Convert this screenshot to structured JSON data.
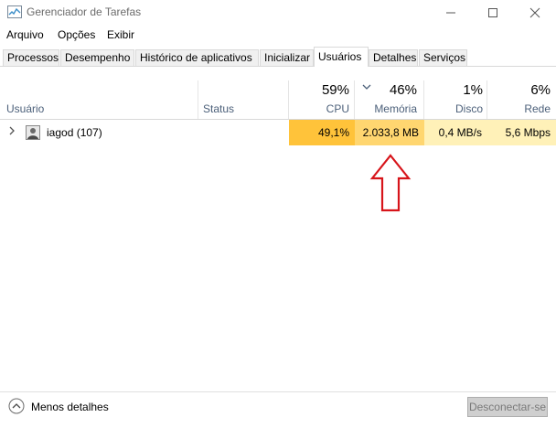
{
  "window": {
    "title": "Gerenciador de Tarefas",
    "minimize_icon": "minimize-icon",
    "maximize_icon": "maximize-icon",
    "close_icon": "close-icon"
  },
  "menu": [
    "Arquivo",
    "Opções",
    "Exibir"
  ],
  "tabs": [
    "Processos",
    "Desempenho",
    "Histórico de aplicativos",
    "Inicializar",
    "Usuários",
    "Detalhes",
    "Serviços"
  ],
  "active_tab": "Usuários",
  "columns": {
    "user": {
      "label": "Usuário"
    },
    "status": {
      "label": "Status"
    },
    "cpu": {
      "label": "CPU",
      "percent": "59%"
    },
    "memory": {
      "label": "Memória",
      "percent": "46%",
      "sort_icon": "chevron-down-icon"
    },
    "disk": {
      "label": "Disco",
      "percent": "1%"
    },
    "network": {
      "label": "Rede",
      "percent": "6%"
    }
  },
  "rows": [
    {
      "name": "iagod (107)",
      "status": "",
      "cpu": "49,1%",
      "memory": "2.033,8 MB",
      "disk": "0,4 MB/s",
      "network": "5,6 Mbps",
      "expander_icon": "chevron-right-icon",
      "avatar_icon": "user-avatar-icon"
    }
  ],
  "footer": {
    "less_details_label": "Menos detalhes",
    "less_details_icon": "chevron-up-circle-icon",
    "disconnect_label": "Desconectar-se"
  },
  "colors": {
    "cpu_heat": "#ffc33a",
    "memory_heat": "#ffd670",
    "low_heat": "#fff1b8",
    "annotation_arrow": "#d7141a"
  }
}
